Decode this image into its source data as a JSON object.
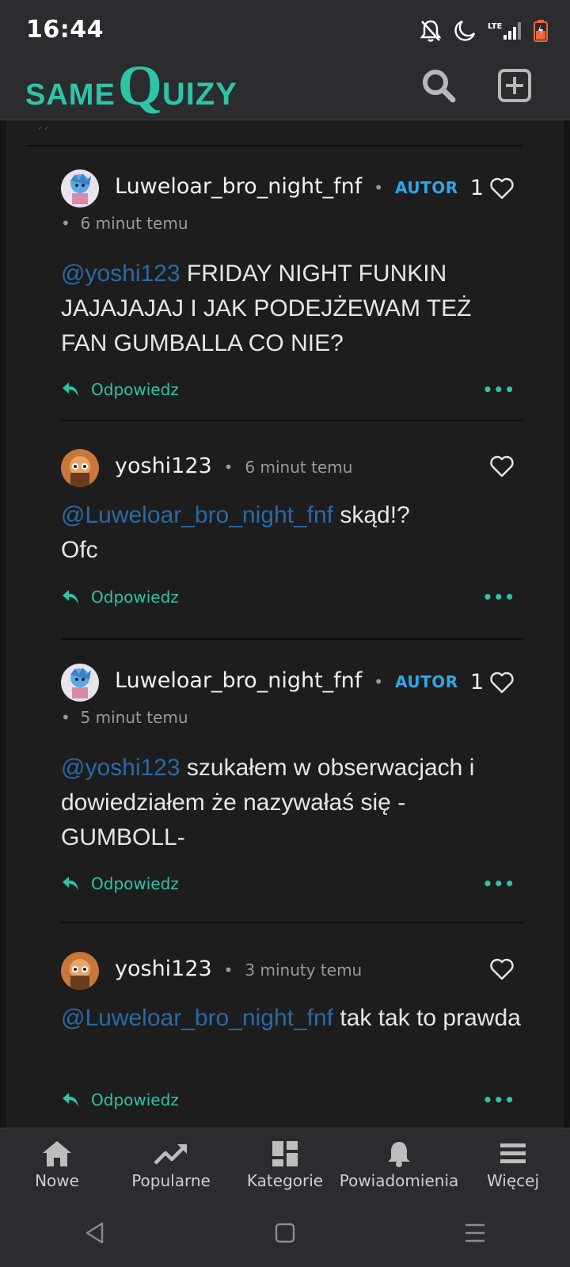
{
  "status_bar": {
    "time": "16:44",
    "network": "LTE",
    "icons": [
      "notifications-off-icon",
      "do-not-disturb-moon-icon",
      "lte-signal-icon",
      "battery-charging-icon"
    ]
  },
  "header": {
    "logo_same": "SAME",
    "logo_q": "Q",
    "logo_uizy": "UIZY",
    "icons": [
      "search-icon",
      "add-box-icon"
    ]
  },
  "colors": {
    "accent": "#2ec4a6",
    "badge": "#2fa6e8",
    "mention": "#2a69a8",
    "background": "#1d1d1d",
    "bar": "#2a2c2f"
  },
  "comments": [
    {
      "author": "Luweloar_bro_night_fnf",
      "badge": "AUTOR",
      "likes": "1",
      "time": "6 minut temu",
      "mention": "@yoshi123",
      "text": " FRIDAY NIGHT FUNKIN JAJAJAJAJ I JAK PODEJŻEWAM TEŻ FAN GUMBALLA CO NIE?",
      "reply_label": "Odpowiedz",
      "more_label": "•••"
    },
    {
      "author": "yoshi123",
      "badge": "",
      "likes": "",
      "time": "6 minut temu",
      "mention": "@Luweloar_bro_night_fnf",
      "text": " skąd!?",
      "text_line2": "Ofc",
      "reply_label": "Odpowiedz",
      "more_label": "•••"
    },
    {
      "author": "Luweloar_bro_night_fnf",
      "badge": "AUTOR",
      "likes": "1",
      "time": "5 minut temu",
      "mention": "@yoshi123",
      "text": " szukałem w obserwacjach i dowiedziałem że nazywałaś się -GUMBOLL-",
      "reply_label": "Odpowiedz",
      "more_label": "•••"
    },
    {
      "author": "yoshi123",
      "badge": "",
      "likes": "",
      "time": "3 minuty temu",
      "mention": "@Luweloar_bro_night_fnf",
      "text": " tak tak to prawda",
      "reply_label": "Odpowiedz",
      "more_label": "•••"
    }
  ],
  "bottom_nav": {
    "items": [
      {
        "label": "Nowe",
        "icon": "home-icon"
      },
      {
        "label": "Popularne",
        "icon": "trending-icon"
      },
      {
        "label": "Kategorie",
        "icon": "dashboard-icon"
      },
      {
        "label": "Powiadomienia",
        "icon": "bell-icon"
      },
      {
        "label": "Więcej",
        "icon": "menu-icon"
      }
    ]
  },
  "system_nav": {
    "icons": [
      "back-triangle-icon",
      "home-square-icon",
      "recents-menu-icon"
    ]
  }
}
